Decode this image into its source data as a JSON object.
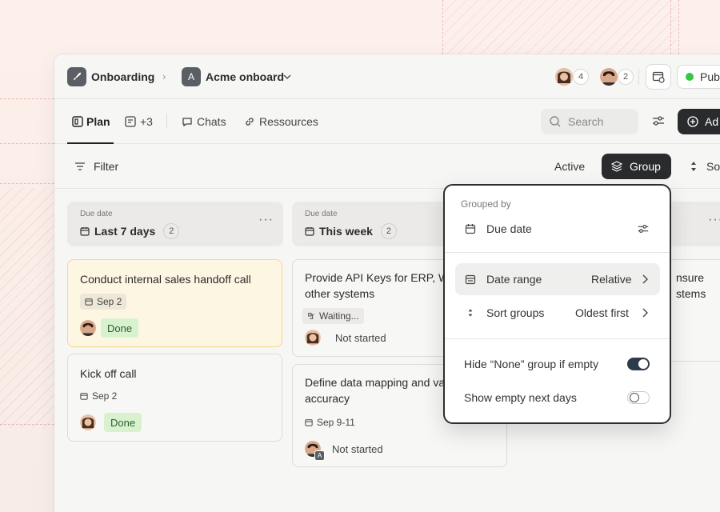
{
  "header": {
    "project_name": "Onboarding",
    "workspace_initial": "A",
    "workspace_name": "Acme onboard",
    "avatar_group_1_count": "4",
    "avatar_group_2_count": "2",
    "publish_label": "Pub"
  },
  "tabs": {
    "plan": "Plan",
    "more": "+3",
    "chats": "Chats",
    "resources": "Ressources",
    "search_placeholder": "Search",
    "add_label": "Ad"
  },
  "toolbar": {
    "filter": "Filter",
    "active": "Active",
    "group": "Group",
    "sort": "Sor"
  },
  "columns": [
    {
      "sub": "Due date",
      "title": "Last 7 days",
      "count": "2",
      "cards": [
        {
          "title": "Conduct internal sales handoff call",
          "date": "Sep 2",
          "status": "Done"
        },
        {
          "title": "Kick off call",
          "date": "Sep 2",
          "status": "Done"
        }
      ]
    },
    {
      "sub": "Due date",
      "title": "This week",
      "count": "2",
      "cards": [
        {
          "title_1": "Provide API Keys for ERP, W",
          "title_2": "other systems",
          "tag": "Waiting...",
          "status": "Not started"
        },
        {
          "title_1": "Define data mapping and val",
          "title_2": "accuracy",
          "date": "Sep 9-11",
          "status": "Not started",
          "assignee_initial": "A"
        }
      ]
    },
    {
      "cards": [
        {
          "title_1": "nsure",
          "title_2": "stems"
        }
      ]
    }
  ],
  "popover": {
    "grouped_by_label": "Grouped by",
    "grouped_by_value": "Due date",
    "date_range_label": "Date range",
    "date_range_value": "Relative",
    "sort_groups_label": "Sort groups",
    "sort_groups_value": "Oldest first",
    "hide_none_label": "Hide “None” group if empty",
    "hide_none_on": true,
    "show_empty_label": "Show empty next days",
    "show_empty_on": false
  },
  "colors": {
    "accent_dark": "#2a2b2d",
    "done_bg": "#d8f2cf",
    "highlight_card": "#fdf6e3",
    "publish_dot": "#38c742"
  }
}
